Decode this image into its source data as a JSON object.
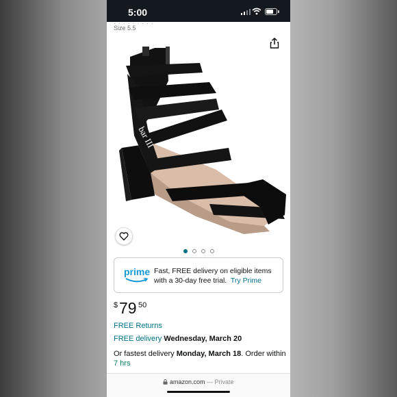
{
  "status_bar": {
    "time": "5:00",
    "icons": [
      "cellular-signal-icon",
      "wifi-icon",
      "battery-icon"
    ]
  },
  "product": {
    "size_label": "Size 5.5",
    "image_name": "black-strappy-block-heel-sandal",
    "image_brand_text": "bar III",
    "gallery": {
      "count": 4,
      "active_index": 0
    }
  },
  "prime": {
    "logo_text": "prime",
    "message": "Fast, FREE delivery on eligible items with a 30-day free trial.",
    "cta": "Try Prime"
  },
  "price": {
    "symbol": "$",
    "whole": "79",
    "fraction": "50"
  },
  "returns": {
    "label": "FREE Returns"
  },
  "delivery": {
    "label": "FREE delivery",
    "date": "Wednesday, March 20"
  },
  "fastest": {
    "prefix": "Or fastest delivery",
    "date": "Monday, March 18",
    "suffix": ". Order within",
    "countdown": "7 hrs"
  },
  "browser": {
    "domain": "amazon.com",
    "separator": "—",
    "mode": "Private"
  },
  "colors": {
    "status_bar_bg": "#14181f",
    "prime_blue": "#1399d6",
    "link_teal": "#007185",
    "dot_active": "#007185"
  }
}
